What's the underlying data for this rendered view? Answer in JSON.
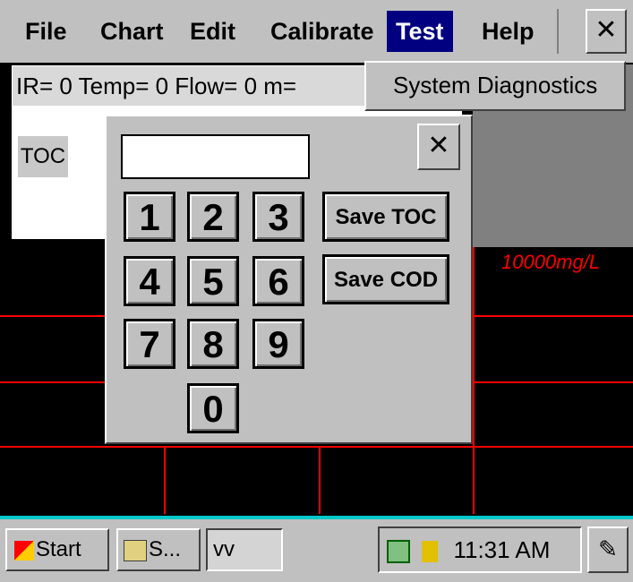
{
  "menu": {
    "items": [
      "File",
      "Chart",
      "Edit",
      "Calibrate",
      "Test",
      "Help"
    ],
    "active": "Test",
    "close_glyph": "✕"
  },
  "status": {
    "readout": "IR=   0 Temp=  0 Flow=  0 m=",
    "toc_label": "TOC"
  },
  "dropdown": {
    "item": "System Diagnostics"
  },
  "chart": {
    "scale_label": "10000mg/L",
    "grid_color": "#ff0000"
  },
  "dialog": {
    "input_value": "",
    "close_glyph": "✕",
    "keys": [
      "1",
      "2",
      "3",
      "4",
      "5",
      "6",
      "7",
      "8",
      "9",
      "0"
    ],
    "save_toc": "Save TOC",
    "save_cod": "Save COD"
  },
  "taskbar": {
    "start": "Start",
    "task1": "S...",
    "task2": "vv",
    "clock": "11:31 AM",
    "accent": "#00c8c8"
  },
  "icons": [
    "start-flag-icon",
    "explorer-task-icon",
    "network-icon",
    "power-plug-icon",
    "desktop-icon"
  ]
}
